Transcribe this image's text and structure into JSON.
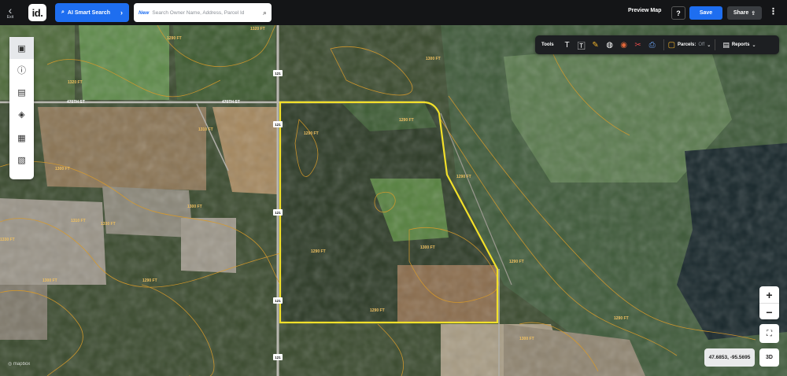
{
  "header": {
    "exit_label": "Exit",
    "logo_text": "id.",
    "ai_search_label": "AI Smart Search",
    "search": {
      "badge": "New",
      "placeholder": "Search Owner Name, Address, Parcel Id"
    },
    "preview_label": "Preview Map",
    "help_label": "?",
    "save_label": "Save",
    "share_label": "Share"
  },
  "toolbar": {
    "tools_label": "Tools",
    "parcels_label": "Parcels:",
    "parcels_state": "Off",
    "reports_label": "Reports"
  },
  "map": {
    "road_labels": [
      "470TH ST",
      "470TH ST"
    ],
    "highway_shields": [
      "121",
      "121",
      "121",
      "121",
      "121"
    ],
    "contour_labels": [
      "1290 FT",
      "1300 FT",
      "1310 FT",
      "1320 FT",
      "1330 FT",
      "1280 FT",
      "1270 FT"
    ],
    "boundary_color": "#f2e02a",
    "contour_color": "#d89a2a"
  },
  "controls": {
    "zoom_in": "+",
    "zoom_out": "−",
    "coordinates": "47.6853, -95.5695",
    "btn_3d": "3D",
    "attribution": "mapbox"
  },
  "icons": [
    "chevron-left-icon",
    "search-icon",
    "share-icon",
    "more-icon",
    "text-icon",
    "label-icon",
    "ruler-icon",
    "globe-icon",
    "target-icon",
    "scissors-icon",
    "print-icon",
    "parcel-icon",
    "chevron-down-icon",
    "report-icon",
    "legend-icon",
    "info-icon",
    "map-icon",
    "layers-icon",
    "buildings-icon",
    "image-icon",
    "fullscreen-icon"
  ]
}
